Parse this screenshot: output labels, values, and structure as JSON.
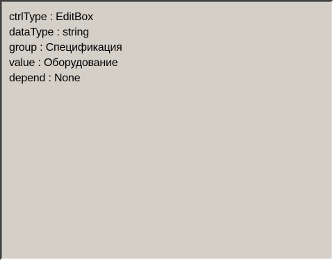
{
  "properties": [
    {
      "key": "ctrlType",
      "value": "EditBox"
    },
    {
      "key": "dataType",
      "value": "string"
    },
    {
      "key": "group",
      "value": "Спецификация"
    },
    {
      "key": "value",
      "value": "Оборудование"
    },
    {
      "key": "depend",
      "value": "None"
    }
  ],
  "separator": " : ",
  "colors": {
    "panel_background": "#d4d0c8",
    "text": "#000000"
  }
}
